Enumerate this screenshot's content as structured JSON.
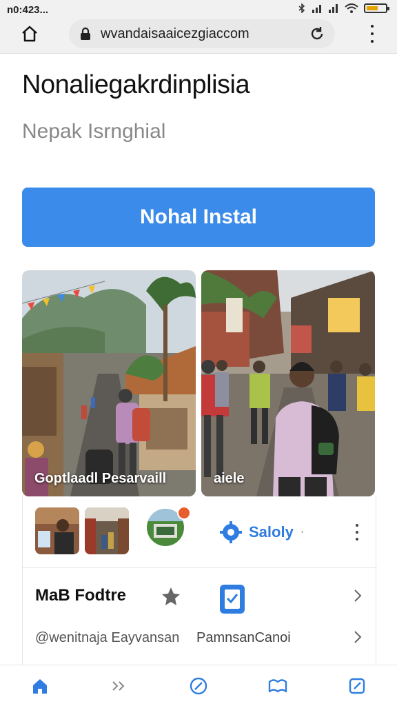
{
  "status_bar": {
    "time": "n0:423..."
  },
  "browser": {
    "url": "wvandaisaaicezgiaccom"
  },
  "page": {
    "title": "Nonaliegakrdinplisia",
    "subtitle": "Nepak Isrnghial",
    "cta_label": "Nohal Instal"
  },
  "photos": [
    {
      "caption": "Goptlaadl Pesarvaill"
    },
    {
      "caption": "aiele"
    }
  ],
  "card": {
    "safety_label": "Saloly",
    "safety_dot": "·",
    "feature_title": "MaB Fodtre",
    "handle": "@wenitnaja Eayvansan",
    "name": "PamnsanCanoi"
  },
  "colors": {
    "accent": "#3b8beb",
    "link_blue": "#2f7de0",
    "badge": "#e85d2c"
  }
}
